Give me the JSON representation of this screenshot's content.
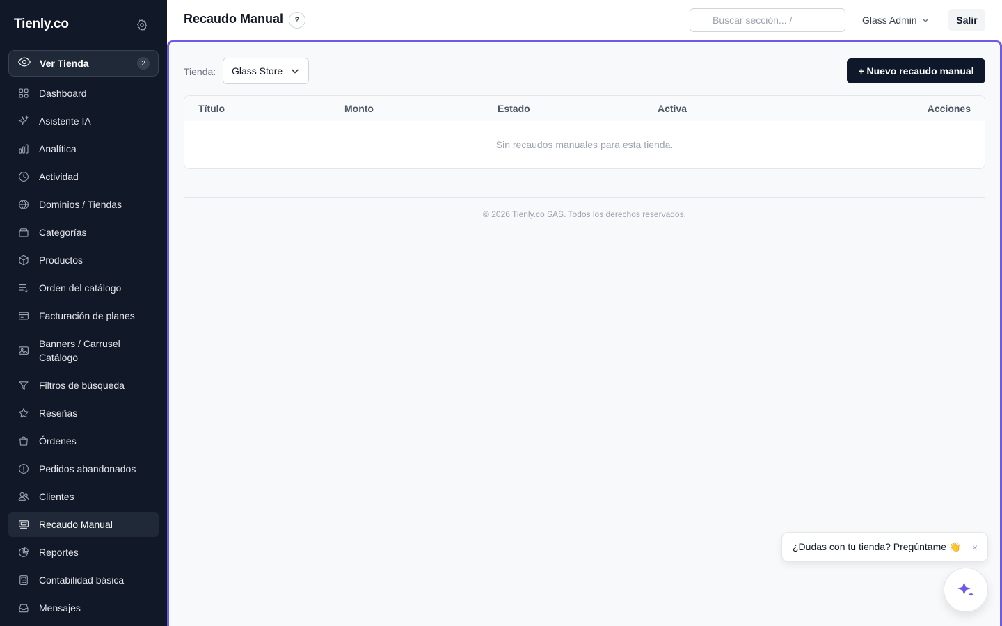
{
  "app": {
    "brand": "Tienly.co"
  },
  "sidebar": {
    "view_store": {
      "label": "Ver Tienda",
      "badge": "2"
    },
    "items": [
      {
        "label": "Dashboard",
        "icon": "grid-icon"
      },
      {
        "label": "Asistente IA",
        "icon": "sparkles-icon"
      },
      {
        "label": "Analítica",
        "icon": "bar-chart-icon"
      },
      {
        "label": "Actividad",
        "icon": "clock-icon"
      },
      {
        "label": "Dominios / Tiendas",
        "icon": "globe-icon"
      },
      {
        "label": "Categorías",
        "icon": "folder-icon"
      },
      {
        "label": "Productos",
        "icon": "box-icon"
      },
      {
        "label": "Orden del catálogo",
        "icon": "sort-list-icon"
      },
      {
        "label": "Facturación de planes",
        "icon": "credit-card-icon"
      },
      {
        "label": "Banners / Carrusel Catálogo",
        "icon": "image-icon"
      },
      {
        "label": "Filtros de búsqueda",
        "icon": "filter-icon"
      },
      {
        "label": "Reseñas",
        "icon": "star-icon"
      },
      {
        "label": "Órdenes",
        "icon": "shopping-bag-icon"
      },
      {
        "label": "Pedidos abandonados",
        "icon": "alert-circle-icon"
      },
      {
        "label": "Clientes",
        "icon": "users-icon"
      },
      {
        "label": "Recaudo Manual",
        "icon": "cash-register-icon",
        "active": true
      },
      {
        "label": "Reportes",
        "icon": "pie-chart-icon"
      },
      {
        "label": "Contabilidad básica",
        "icon": "calculator-icon"
      },
      {
        "label": "Mensajes",
        "icon": "inbox-icon"
      }
    ]
  },
  "header": {
    "title": "Recaudo Manual",
    "help": "?",
    "search_placeholder": "Buscar sección...  /",
    "user": "Glass Admin",
    "logout": "Salir"
  },
  "main": {
    "store_label": "Tienda:",
    "store_selected": "Glass Store",
    "new_button": "+ Nuevo recaudo manual",
    "table": {
      "columns": [
        "Título",
        "Monto",
        "Estado",
        "Activa",
        "Acciones"
      ],
      "empty": "Sin recaudos manuales para esta tienda."
    },
    "footer": "© 2026 Tienly.co SAS. Todos los derechos reservados."
  },
  "chat": {
    "tip": "¿Dudas con tu tienda? Pregúntame 👋",
    "close": "×"
  },
  "colors": {
    "sidebar_bg": "#111827",
    "accent_frame": "#6d5ae6",
    "primary_button": "#0f172a",
    "fab_star": "#6d5ae6"
  }
}
